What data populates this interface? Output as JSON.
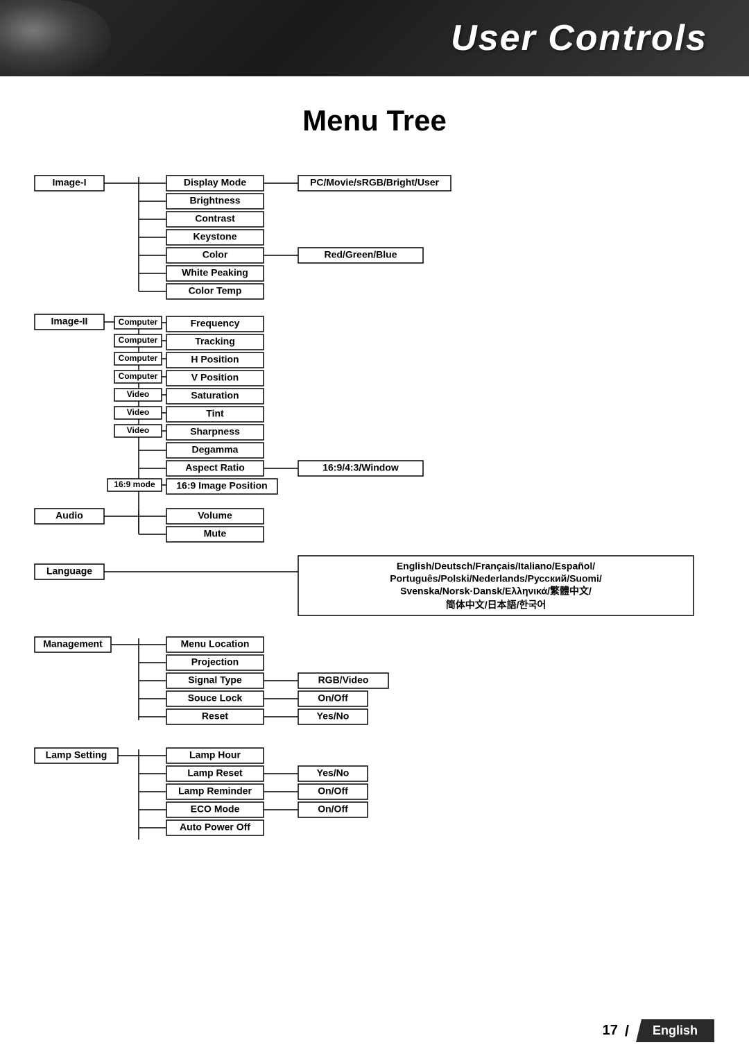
{
  "header": {
    "title": "User Controls"
  },
  "page": {
    "title": "Menu Tree"
  },
  "footer": {
    "page_number": "17",
    "language": "English"
  },
  "tree": {
    "sections": [
      {
        "id": "image1",
        "level1": "Image-I",
        "level1_tag": "",
        "items": [
          {
            "label": "Display Mode",
            "options": "PC/Movie/sRGB/Bright/User"
          },
          {
            "label": "Brightness",
            "options": ""
          },
          {
            "label": "Contrast",
            "options": ""
          },
          {
            "label": "Keystone",
            "options": ""
          },
          {
            "label": "Color",
            "options": "Red/Green/Blue"
          },
          {
            "label": "White Peaking",
            "options": ""
          },
          {
            "label": "Color Temp",
            "options": ""
          }
        ]
      },
      {
        "id": "image2",
        "level1": "Image-II",
        "items": [
          {
            "label": "Frequency",
            "options": "",
            "tag": "Computer"
          },
          {
            "label": "Tracking",
            "options": "",
            "tag": "Computer"
          },
          {
            "label": "H Position",
            "options": "",
            "tag": "Computer"
          },
          {
            "label": "V Position",
            "options": "",
            "tag": "Computer"
          },
          {
            "label": "Saturation",
            "options": "",
            "tag": "Video"
          },
          {
            "label": "Tint",
            "options": "",
            "tag": "Video"
          },
          {
            "label": "Sharpness",
            "options": "",
            "tag": "Video"
          },
          {
            "label": "Degamma",
            "options": ""
          },
          {
            "label": "Aspect Ratio",
            "options": "16:9/4:3/Window"
          },
          {
            "label": "16:9 Image Position",
            "options": "",
            "tag": "16:9 mode"
          }
        ]
      },
      {
        "id": "audio",
        "level1": "Audio",
        "items": [
          {
            "label": "Volume",
            "options": ""
          },
          {
            "label": "Mute",
            "options": ""
          }
        ]
      },
      {
        "id": "language",
        "level1": "Language",
        "items": [],
        "options": "English/Deutsch/Français/Italiano/Español/\nPortuguès/Polski/Nederlands/Русский/Suomi/\nSvenska/Norsk·Dansk/Ελληνικά/繁體中文/\n简体中文/日本語/한국어"
      },
      {
        "id": "management",
        "level1": "Management",
        "items": [
          {
            "label": "Menu Location",
            "options": ""
          },
          {
            "label": "Projection",
            "options": ""
          },
          {
            "label": "Signal Type",
            "options": "RGB/Video"
          },
          {
            "label": "Souce Lock",
            "options": "On/Off"
          },
          {
            "label": "Reset",
            "options": "Yes/No"
          }
        ]
      },
      {
        "id": "lamp",
        "level1": "Lamp Setting",
        "items": [
          {
            "label": "Lamp Hour",
            "options": ""
          },
          {
            "label": "Lamp Reset",
            "options": "Yes/No"
          },
          {
            "label": "Lamp Reminder",
            "options": "On/Off"
          },
          {
            "label": "ECO Mode",
            "options": "On/Off"
          },
          {
            "label": "Auto Power Off",
            "options": ""
          }
        ]
      }
    ]
  }
}
